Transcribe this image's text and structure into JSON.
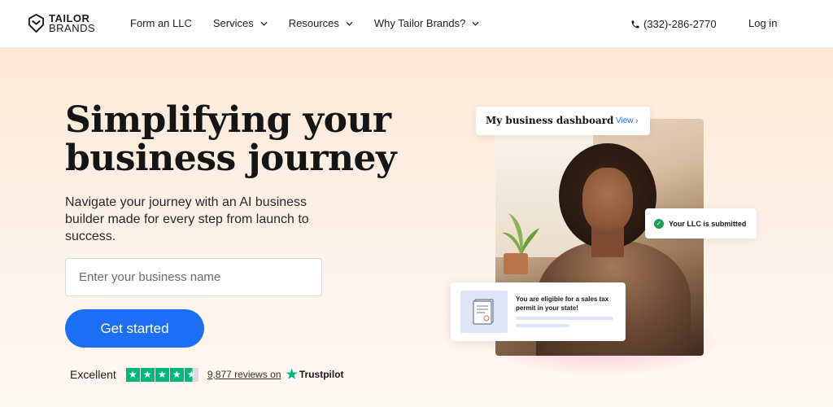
{
  "brand": {
    "line1": "TAILOR",
    "line2": "BRANDS"
  },
  "nav": {
    "items": [
      {
        "label": "Form an LLC",
        "has_dropdown": false
      },
      {
        "label": "Services",
        "has_dropdown": true
      },
      {
        "label": "Resources",
        "has_dropdown": true
      },
      {
        "label": "Why Tailor Brands?",
        "has_dropdown": true
      }
    ],
    "phone": "(332)-286-2770",
    "login": "Log in"
  },
  "hero": {
    "headline": "Simplifying your business journey",
    "subtitle": "Navigate your journey with an AI business builder made for every step from launch to success.",
    "input_placeholder": "Enter your business name",
    "cta": "Get started"
  },
  "rating": {
    "label": "Excellent",
    "stars": 4.5,
    "reviews": "9,877 reviews on",
    "provider": "Trustpilot"
  },
  "illustration": {
    "dashboard_title": "My business dashboard",
    "dashboard_link": "View ›",
    "llc_status": "Your LLC is submitted",
    "tax_notice": "You are eligible for a sales tax permit in your state!"
  },
  "colors": {
    "accent": "#1c6ff5",
    "trustpilot": "#00b67a",
    "hero_bg": "#fde8d6"
  },
  "icons": {
    "phone": "phone-icon",
    "chevron": "chevron-down-icon",
    "check": "check-circle-icon",
    "star": "star-icon"
  }
}
